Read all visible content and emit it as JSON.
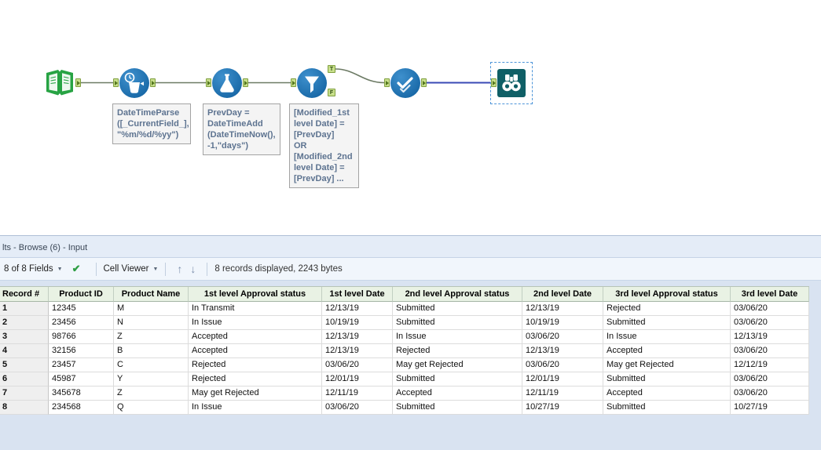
{
  "canvas": {
    "filter": {
      "true_label": "T",
      "false_label": "F"
    },
    "annotations": [
      {
        "text": "DateTimeParse\n([_CurrentField_],\n\"%m/%d/%yy\")"
      },
      {
        "text": "PrevDay =\nDateTimeAdd\n(DateTimeNow(),\n-1,\"days\")"
      },
      {
        "text": "[Modified_1st\nlevel Date] =\n[PrevDay]\nOR\n[Modified_2nd\nlevel Date] =\n[PrevDay] ..."
      }
    ]
  },
  "results": {
    "title": "lts - Browse (6) - Input",
    "toolbar": {
      "fields": "8 of 8 Fields",
      "cell_viewer": "Cell Viewer",
      "status": "8 records displayed, 2243 bytes"
    },
    "icons": {
      "dropdown": "▼",
      "check": "✔",
      "up": "↑",
      "down": "↓"
    },
    "table": {
      "columns": [
        "Record #",
        "Product ID",
        "Product Name",
        "1st level Approval status",
        "1st level Date",
        "2nd level Approval status",
        "2nd level Date",
        "3rd level Approval status",
        "3rd level Date"
      ],
      "rows": [
        [
          "1",
          "12345",
          "M",
          "In Transmit",
          "12/13/19",
          "Submitted",
          "12/13/19",
          "Rejected",
          "03/06/20"
        ],
        [
          "2",
          "23456",
          "N",
          "In Issue",
          "10/19/19",
          "Submitted",
          "10/19/19",
          "Submitted",
          "03/06/20"
        ],
        [
          "3",
          "98766",
          "Z",
          "Accepted",
          "12/13/19",
          "In Issue",
          "03/06/20",
          "In Issue",
          "12/13/19"
        ],
        [
          "4",
          "32156",
          "B",
          "Accepted",
          "12/13/19",
          "Rejected",
          "12/13/19",
          "Accepted",
          "03/06/20"
        ],
        [
          "5",
          "23457",
          "C",
          "Rejected",
          "03/06/20",
          "May get Rejected",
          "03/06/20",
          "May get Rejected",
          "12/12/19"
        ],
        [
          "6",
          "45987",
          "Y",
          "Rejected",
          "12/01/19",
          "Submitted",
          "12/01/19",
          "Submitted",
          "03/06/20"
        ],
        [
          "7",
          "345678",
          "Z",
          "May get Rejected",
          "12/11/19",
          "Accepted",
          "12/11/19",
          "Accepted",
          "03/06/20"
        ],
        [
          "8",
          "234568",
          "Q",
          "In Issue",
          "03/06/20",
          "Submitted",
          "10/27/19",
          "Submitted",
          "10/27/19"
        ]
      ]
    }
  }
}
